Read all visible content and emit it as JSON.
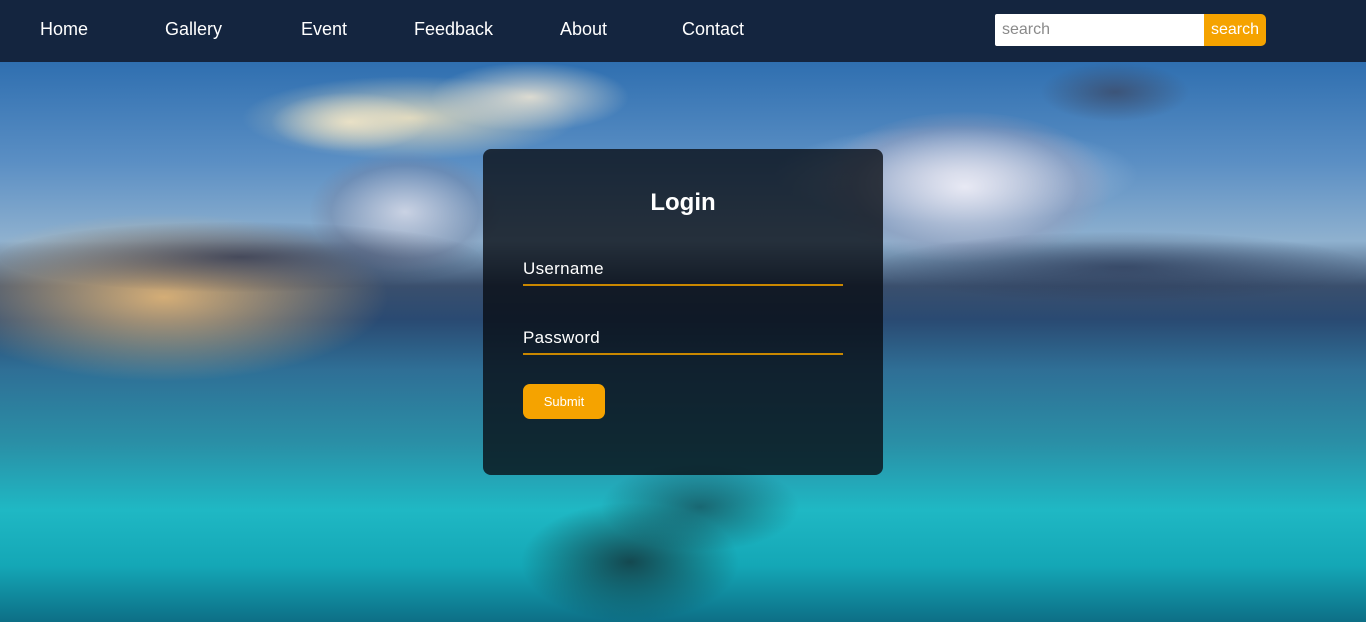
{
  "nav": {
    "items": [
      {
        "label": "Home"
      },
      {
        "label": "Gallery"
      },
      {
        "label": "Event"
      },
      {
        "label": "Feedback"
      },
      {
        "label": "About"
      },
      {
        "label": "Contact"
      }
    ]
  },
  "search": {
    "placeholder": "search",
    "button_label": "search"
  },
  "login": {
    "title": "Login",
    "username_placeholder": "Username",
    "password_placeholder": "Password",
    "submit_label": "Submit"
  },
  "colors": {
    "navbar": "#14253f",
    "accent": "#f5a300",
    "card": "rgba(8,12,18,0.78)",
    "text": "#ffffff"
  }
}
